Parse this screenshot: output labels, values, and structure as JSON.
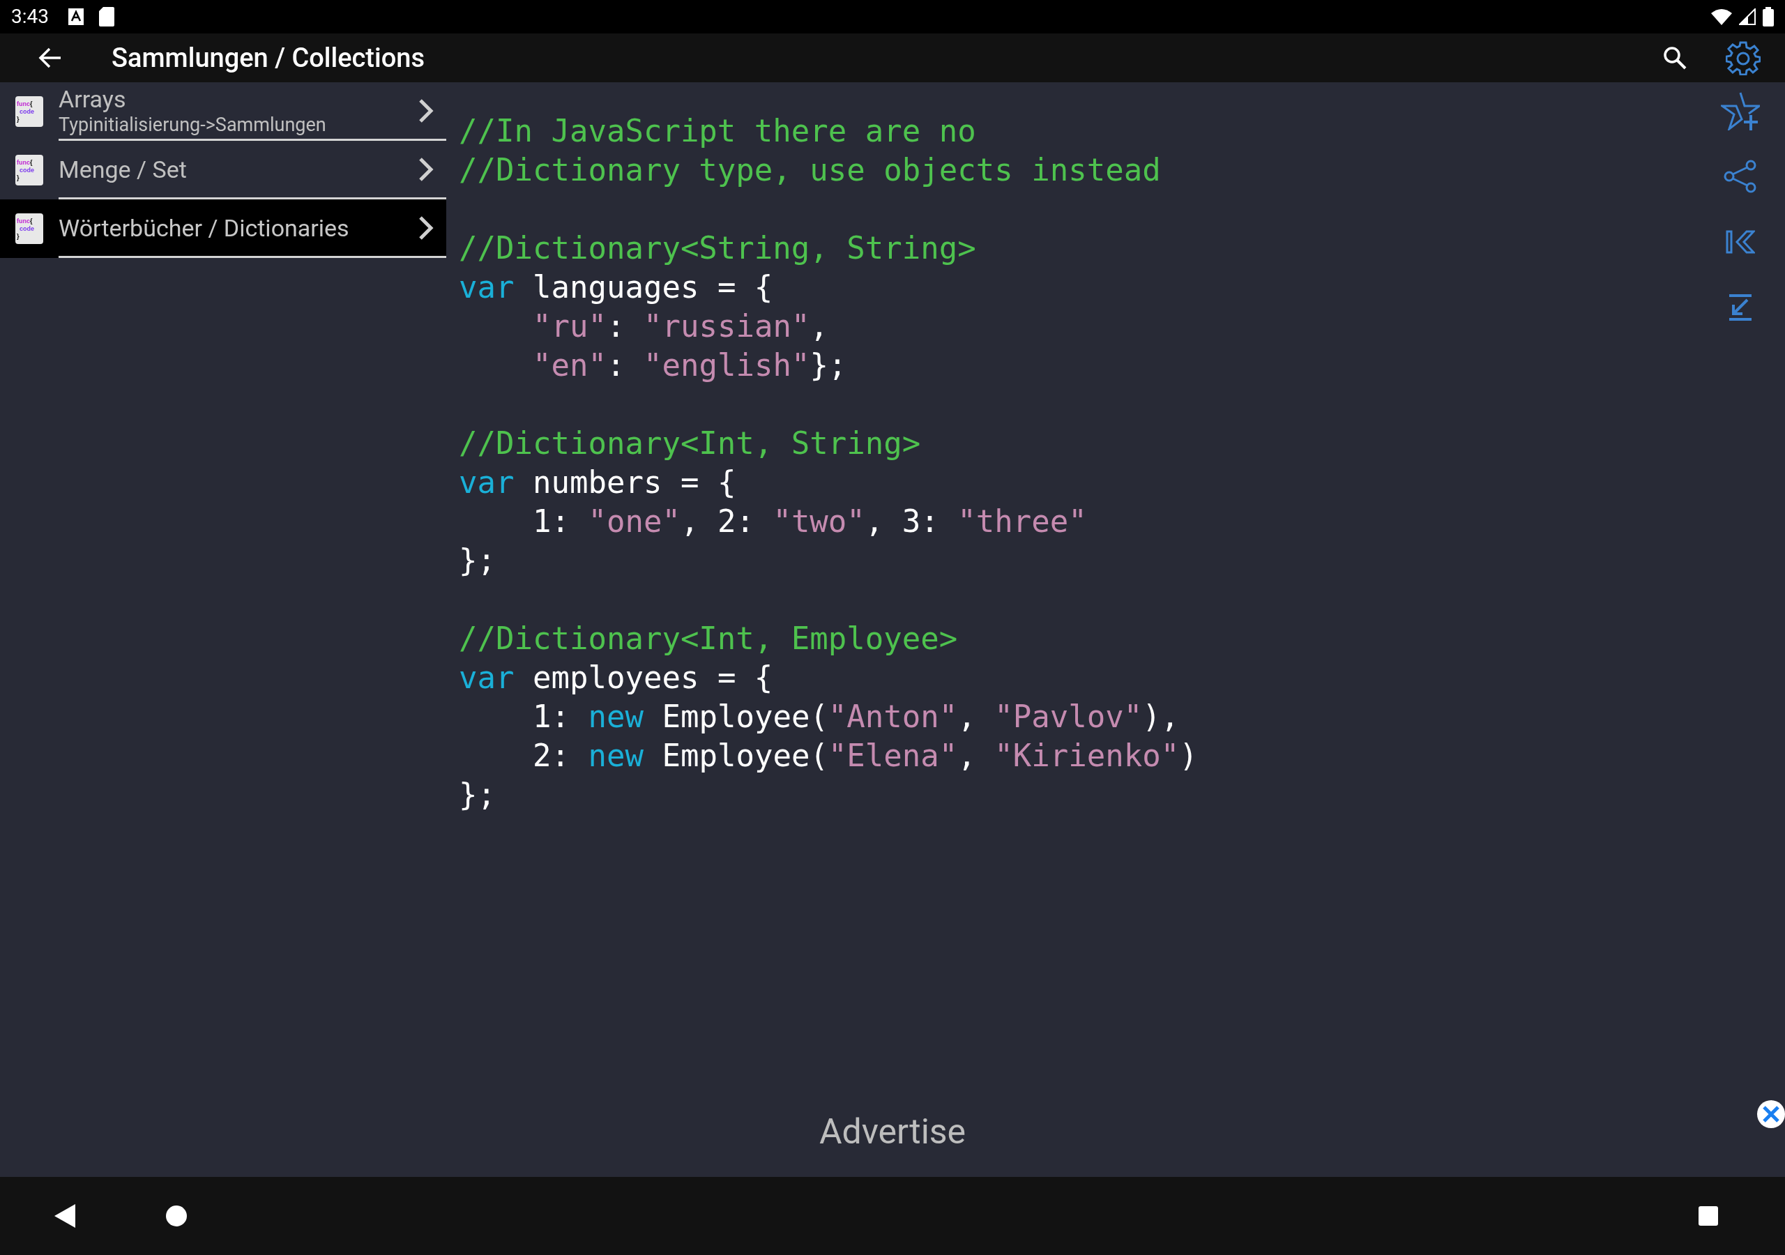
{
  "status_bar": {
    "time": "3:43"
  },
  "app_bar": {
    "title": "Sammlungen / Collections"
  },
  "topics": [
    {
      "title": "Arrays",
      "subtitle": "Typinitialisierung->Sammlungen",
      "selected": false,
      "icon_lines": [
        "func",
        "{",
        "code",
        "}"
      ]
    },
    {
      "title": "Menge / Set",
      "selected": false,
      "icon_lines": [
        "func",
        "{",
        "code",
        "}"
      ]
    },
    {
      "title": "Wörterbücher / Dictionaries",
      "selected": true,
      "icon_lines": [
        "func",
        "{",
        "code",
        "}"
      ]
    }
  ],
  "code_blocks": [
    [
      {
        "indented": false,
        "tokens": [
          {
            "kind": "comment",
            "text": "//In JavaScript there are no"
          }
        ]
      },
      {
        "indented": false,
        "tokens": [
          {
            "kind": "comment",
            "text": "//Dictionary type, use objects instead"
          }
        ]
      }
    ],
    [
      {
        "indented": false,
        "tokens": [
          {
            "kind": "comment",
            "text": "//Dictionary<String, String>"
          }
        ]
      },
      {
        "indented": false,
        "tokens": [
          {
            "kind": "keyword",
            "text": "var"
          },
          {
            "kind": "plain",
            "text": " languages = {"
          }
        ]
      },
      {
        "indented": true,
        "tokens": [
          {
            "kind": "string",
            "text": "\"ru\""
          },
          {
            "kind": "plain",
            "text": ": "
          },
          {
            "kind": "string",
            "text": "\"russian\""
          },
          {
            "kind": "plain",
            "text": ","
          }
        ]
      },
      {
        "indented": true,
        "tokens": [
          {
            "kind": "string",
            "text": "\"en\""
          },
          {
            "kind": "plain",
            "text": ": "
          },
          {
            "kind": "string",
            "text": "\"english\""
          },
          {
            "kind": "plain",
            "text": "};"
          }
        ]
      }
    ],
    [
      {
        "indented": false,
        "tokens": [
          {
            "kind": "comment",
            "text": "//Dictionary<Int, String>"
          }
        ]
      },
      {
        "indented": false,
        "tokens": [
          {
            "kind": "keyword",
            "text": "var"
          },
          {
            "kind": "plain",
            "text": " numbers = {"
          }
        ]
      },
      {
        "indented": true,
        "tokens": [
          {
            "kind": "plain",
            "text": "1: "
          },
          {
            "kind": "string",
            "text": "\"one\""
          },
          {
            "kind": "plain",
            "text": ", 2: "
          },
          {
            "kind": "string",
            "text": "\"two\""
          },
          {
            "kind": "plain",
            "text": ", 3: "
          },
          {
            "kind": "string",
            "text": "\"three\""
          }
        ]
      },
      {
        "indented": false,
        "tokens": [
          {
            "kind": "plain",
            "text": "};"
          }
        ]
      }
    ],
    [
      {
        "indented": false,
        "tokens": [
          {
            "kind": "comment",
            "text": "//Dictionary<Int, Employee>"
          }
        ]
      },
      {
        "indented": false,
        "tokens": [
          {
            "kind": "keyword",
            "text": "var"
          },
          {
            "kind": "plain",
            "text": " employees = {"
          }
        ]
      },
      {
        "indented": true,
        "tokens": [
          {
            "kind": "plain",
            "text": "1: "
          },
          {
            "kind": "keyword",
            "text": "new"
          },
          {
            "kind": "plain",
            "text": " Employee("
          },
          {
            "kind": "string",
            "text": "\"Anton\""
          },
          {
            "kind": "plain",
            "text": ", "
          },
          {
            "kind": "string",
            "text": "\"Pavlov\""
          },
          {
            "kind": "plain",
            "text": "),"
          }
        ]
      },
      {
        "indented": true,
        "tokens": [
          {
            "kind": "plain",
            "text": "2: "
          },
          {
            "kind": "keyword",
            "text": "new"
          },
          {
            "kind": "plain",
            "text": " Employee("
          },
          {
            "kind": "string",
            "text": "\"Elena\""
          },
          {
            "kind": "plain",
            "text": ", "
          },
          {
            "kind": "string",
            "text": "\"Kirienko\""
          },
          {
            "kind": "plain",
            "text": ")"
          }
        ]
      },
      {
        "indented": false,
        "tokens": [
          {
            "kind": "plain",
            "text": "};"
          }
        ]
      }
    ]
  ],
  "ad": {
    "label": "Advertise"
  }
}
